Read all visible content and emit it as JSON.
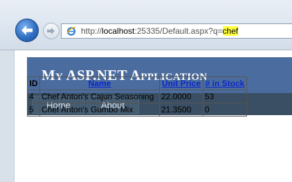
{
  "browser": {
    "url_prefix": "http://",
    "url_host": "localhost",
    "url_path": ":25335/Default.aspx?q=",
    "url_query_highlight": "chef",
    "icons": [
      "back-arrow-icon",
      "forward-arrow-icon",
      "ie-page-icon"
    ]
  },
  "site": {
    "title": "My ASP.NET Application",
    "menu": [
      {
        "label": "Home"
      },
      {
        "label": "About"
      }
    ]
  },
  "products_table": {
    "headers": {
      "id": "ID",
      "name": "Name",
      "unit_price": "Unit Price",
      "in_stock": "# in Stock"
    },
    "rows": [
      {
        "id": "4",
        "name": "Chef Anton's Cajun Seasoning",
        "unit_price": "22.0000",
        "in_stock": "53"
      },
      {
        "id": "5",
        "name": "Chef Anton's Gumbo Mix",
        "unit_price": "21.3500",
        "in_stock": "0"
      }
    ]
  },
  "colors": {
    "header_bg": "#4b6c9e",
    "menu_bg": "#3a4f63",
    "link": "#0b27c9",
    "query_highlight": "#ffff3a"
  }
}
